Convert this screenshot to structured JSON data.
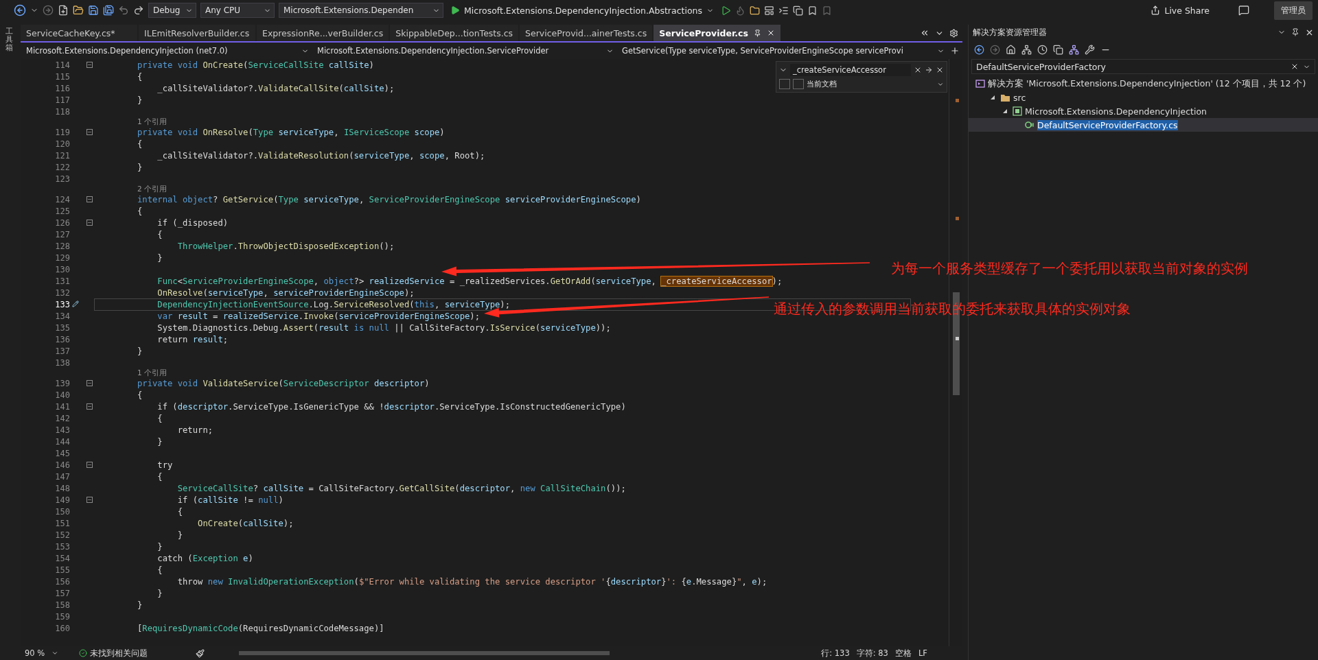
{
  "toolbar": {
    "configuration": "Debug",
    "platform": "Any CPU",
    "project": "Microsoft.Extensions.Dependen",
    "start_target": "Microsoft.Extensions.DependencyInjection.Abstractions",
    "live_share": "Live Share",
    "user_badge": "管理员"
  },
  "side_strip": {
    "label": "工具箱"
  },
  "tabs": [
    {
      "label": "ServiceCacheKey.cs*",
      "selected": false
    },
    {
      "label": "ILEmitResolverBuilder.cs",
      "selected": false
    },
    {
      "label": "ExpressionRe...verBuilder.cs",
      "selected": false
    },
    {
      "label": "SkippableDep...tionTests.cs",
      "selected": false
    },
    {
      "label": "ServiceProvid...ainerTests.cs",
      "selected": false
    },
    {
      "label": "ServiceProvider.cs",
      "selected": true
    }
  ],
  "nav_bar": {
    "project": "Microsoft.Extensions.DependencyInjection (net7.0)",
    "type": "Microsoft.Extensions.DependencyInjection.ServiceProvider",
    "member": "GetService(Type serviceType, ServiceProviderEngineScope serviceProvi"
  },
  "find": {
    "query": "_createServiceAccessor",
    "scope": "当前文档"
  },
  "code": {
    "lines": [
      {
        "kind": "code",
        "number": "114",
        "fold": true,
        "current": false,
        "tokens": [
          {
            "kind": "keyword",
            "text": "private void"
          },
          {
            "kind": "method",
            "text": " OnCreate"
          },
          {
            "kind": "plain",
            "text": "("
          },
          {
            "kind": "type",
            "text": "ServiceCallSite"
          },
          {
            "kind": "variable",
            "text": " callSite"
          },
          {
            "kind": "plain",
            "text": ")"
          }
        ]
      },
      {
        "kind": "code",
        "number": "115",
        "fold": false,
        "current": false,
        "tokens": [
          {
            "kind": "plain",
            "text": "{"
          }
        ]
      },
      {
        "kind": "code",
        "number": "116",
        "fold": false,
        "current": false,
        "tokens": [
          {
            "kind": "plain",
            "text": "    _callSiteValidator?."
          },
          {
            "kind": "method",
            "text": "ValidateCallSite"
          },
          {
            "kind": "plain",
            "text": "("
          },
          {
            "kind": "variable",
            "text": "callSite"
          },
          {
            "kind": "plain",
            "text": ");"
          }
        ]
      },
      {
        "kind": "code",
        "number": "117",
        "fold": false,
        "current": false,
        "tokens": [
          {
            "kind": "plain",
            "text": "}"
          }
        ]
      },
      {
        "kind": "code",
        "number": "118",
        "fold": false,
        "current": false
      },
      {
        "kind": "lens",
        "text": "1 个引用"
      },
      {
        "kind": "code",
        "number": "119",
        "fold": true,
        "current": false,
        "tokens": [
          {
            "kind": "keyword",
            "text": "private void"
          },
          {
            "kind": "method",
            "text": " OnResolve"
          },
          {
            "kind": "plain",
            "text": "("
          },
          {
            "kind": "type",
            "text": "Type"
          },
          {
            "kind": "variable",
            "text": " serviceType"
          },
          {
            "kind": "plain",
            "text": ", "
          },
          {
            "kind": "type",
            "text": "IServiceScope"
          },
          {
            "kind": "variable",
            "text": " scope"
          },
          {
            "kind": "plain",
            "text": ")"
          }
        ]
      },
      {
        "kind": "code",
        "number": "120",
        "fold": false,
        "current": false,
        "tokens": [
          {
            "kind": "plain",
            "text": "{"
          }
        ]
      },
      {
        "kind": "code",
        "number": "121",
        "fold": false,
        "current": false,
        "tokens": [
          {
            "kind": "plain",
            "text": "    _callSiteValidator?."
          },
          {
            "kind": "method",
            "text": "ValidateResolution"
          },
          {
            "kind": "plain",
            "text": "("
          },
          {
            "kind": "variable",
            "text": "serviceType"
          },
          {
            "kind": "plain",
            "text": ", "
          },
          {
            "kind": "variable",
            "text": "scope"
          },
          {
            "kind": "plain",
            "text": ", Root);"
          }
        ]
      },
      {
        "kind": "code",
        "number": "122",
        "fold": false,
        "current": false,
        "tokens": [
          {
            "kind": "plain",
            "text": "}"
          }
        ]
      },
      {
        "kind": "code",
        "number": "123",
        "fold": false,
        "current": false
      },
      {
        "kind": "lens",
        "text": "2 个引用"
      },
      {
        "kind": "code",
        "number": "124",
        "fold": true,
        "current": false,
        "tokens": [
          {
            "kind": "keyword",
            "text": "internal object"
          },
          {
            "kind": "plain",
            "text": "? "
          },
          {
            "kind": "method",
            "text": "GetService"
          },
          {
            "kind": "plain",
            "text": "("
          },
          {
            "kind": "type",
            "text": "Type"
          },
          {
            "kind": "variable",
            "text": " serviceType"
          },
          {
            "kind": "plain",
            "text": ", "
          },
          {
            "kind": "type",
            "text": "ServiceProviderEngineScope"
          },
          {
            "kind": "variable",
            "text": " serviceProviderEngineScope"
          },
          {
            "kind": "plain",
            "text": ")"
          }
        ]
      },
      {
        "kind": "code",
        "number": "125",
        "fold": false,
        "current": false,
        "tokens": [
          {
            "kind": "plain",
            "text": "{"
          }
        ]
      },
      {
        "kind": "code",
        "number": "126",
        "fold": true,
        "current": false,
        "tokens": [
          {
            "kind": "plain",
            "text": "    if (_disposed)"
          }
        ]
      },
      {
        "kind": "code",
        "number": "127",
        "fold": false,
        "current": false,
        "tokens": [
          {
            "kind": "plain",
            "text": "    {"
          }
        ]
      },
      {
        "kind": "code",
        "number": "128",
        "fold": false,
        "current": false,
        "tokens": [
          {
            "kind": "type",
            "text": "        ThrowHelper"
          },
          {
            "kind": "plain",
            "text": "."
          },
          {
            "kind": "method",
            "text": "ThrowObjectDisposedException"
          },
          {
            "kind": "plain",
            "text": "();"
          }
        ]
      },
      {
        "kind": "code",
        "number": "129",
        "fold": false,
        "current": false,
        "tokens": [
          {
            "kind": "plain",
            "text": "    }"
          }
        ]
      },
      {
        "kind": "code",
        "number": "130",
        "fold": false,
        "current": false
      },
      {
        "kind": "code",
        "number": "131",
        "fold": false,
        "current": false,
        "tokens": [
          {
            "kind": "type",
            "text": "    Func"
          },
          {
            "kind": "plain",
            "text": "<"
          },
          {
            "kind": "type",
            "text": "ServiceProviderEngineScope"
          },
          {
            "kind": "plain",
            "text": ", "
          },
          {
            "kind": "keyword",
            "text": "object"
          },
          {
            "kind": "plain",
            "text": "?> "
          },
          {
            "kind": "variable",
            "text": "realizedService"
          },
          {
            "kind": "plain",
            "text": " = _realizedServices."
          },
          {
            "kind": "method",
            "text": "GetOrAdd"
          },
          {
            "kind": "plain",
            "text": "("
          },
          {
            "kind": "variable",
            "text": "serviceType"
          },
          {
            "kind": "plain",
            "text": ", "
          },
          {
            "kind": "match",
            "text": "_createServiceAccessor"
          },
          {
            "kind": "plain",
            "text": ");"
          }
        ]
      },
      {
        "kind": "code",
        "number": "132",
        "fold": false,
        "current": false,
        "tokens": [
          {
            "kind": "method",
            "text": "    OnResolve"
          },
          {
            "kind": "plain",
            "text": "("
          },
          {
            "kind": "variable",
            "text": "serviceType"
          },
          {
            "kind": "plain",
            "text": ", "
          },
          {
            "kind": "variable",
            "text": "serviceProviderEngineScope"
          },
          {
            "kind": "plain",
            "text": ");"
          }
        ]
      },
      {
        "kind": "code",
        "number": "133",
        "fold": false,
        "current": true,
        "tokens": [
          {
            "kind": "type",
            "text": "    DependencyInjectionEventSource"
          },
          {
            "kind": "plain",
            "text": ".Log."
          },
          {
            "kind": "method",
            "text": "ServiceResolved"
          },
          {
            "kind": "plain",
            "text": "("
          },
          {
            "kind": "keyword",
            "text": "this"
          },
          {
            "kind": "plain",
            "text": ", "
          },
          {
            "kind": "variable",
            "text": "serviceType"
          },
          {
            "kind": "plain",
            "text": ");"
          }
        ]
      },
      {
        "kind": "code",
        "number": "134",
        "fold": false,
        "current": false,
        "tokens": [
          {
            "kind": "keyword",
            "text": "    var"
          },
          {
            "kind": "variable",
            "text": " result"
          },
          {
            "kind": "plain",
            "text": " = "
          },
          {
            "kind": "variable",
            "text": "realizedService"
          },
          {
            "kind": "plain",
            "text": "."
          },
          {
            "kind": "method",
            "text": "Invoke"
          },
          {
            "kind": "plain",
            "text": "("
          },
          {
            "kind": "variable",
            "text": "serviceProviderEngineScope"
          },
          {
            "kind": "plain",
            "text": ");"
          }
        ]
      },
      {
        "kind": "code",
        "number": "135",
        "fold": false,
        "current": false,
        "tokens": [
          {
            "kind": "plain",
            "text": "    System.Diagnostics.Debug."
          },
          {
            "kind": "method",
            "text": "Assert"
          },
          {
            "kind": "plain",
            "text": "("
          },
          {
            "kind": "variable",
            "text": "result"
          },
          {
            "kind": "keyword",
            "text": " is null"
          },
          {
            "kind": "plain",
            "text": " || CallSiteFactory."
          },
          {
            "kind": "method",
            "text": "IsService"
          },
          {
            "kind": "plain",
            "text": "("
          },
          {
            "kind": "variable",
            "text": "serviceType"
          },
          {
            "kind": "plain",
            "text": "));"
          }
        ]
      },
      {
        "kind": "code",
        "number": "136",
        "fold": false,
        "current": false,
        "tokens": [
          {
            "kind": "plain",
            "text": "    return "
          },
          {
            "kind": "variable",
            "text": "result"
          },
          {
            "kind": "plain",
            "text": ";"
          }
        ]
      },
      {
        "kind": "code",
        "number": "137",
        "fold": false,
        "current": false,
        "tokens": [
          {
            "kind": "plain",
            "text": "}"
          }
        ]
      },
      {
        "kind": "code",
        "number": "138",
        "fold": false,
        "current": false
      },
      {
        "kind": "lens",
        "text": "1 个引用"
      },
      {
        "kind": "code",
        "number": "139",
        "fold": true,
        "current": false,
        "tokens": [
          {
            "kind": "keyword",
            "text": "private void"
          },
          {
            "kind": "method",
            "text": " ValidateService"
          },
          {
            "kind": "plain",
            "text": "("
          },
          {
            "kind": "type",
            "text": "ServiceDescriptor"
          },
          {
            "kind": "variable",
            "text": " descriptor"
          },
          {
            "kind": "plain",
            "text": ")"
          }
        ]
      },
      {
        "kind": "code",
        "number": "140",
        "fold": false,
        "current": false,
        "tokens": [
          {
            "kind": "plain",
            "text": "{"
          }
        ]
      },
      {
        "kind": "code",
        "number": "141",
        "fold": true,
        "current": false,
        "tokens": [
          {
            "kind": "plain",
            "text": "    if ("
          },
          {
            "kind": "variable",
            "text": "descriptor"
          },
          {
            "kind": "plain",
            "text": ".ServiceType.IsGenericType && !"
          },
          {
            "kind": "variable",
            "text": "descriptor"
          },
          {
            "kind": "plain",
            "text": ".ServiceType.IsConstructedGenericType)"
          }
        ]
      },
      {
        "kind": "code",
        "number": "142",
        "fold": false,
        "current": false,
        "tokens": [
          {
            "kind": "plain",
            "text": "    {"
          }
        ]
      },
      {
        "kind": "code",
        "number": "143",
        "fold": false,
        "current": false,
        "tokens": [
          {
            "kind": "plain",
            "text": "        return;"
          }
        ]
      },
      {
        "kind": "code",
        "number": "144",
        "fold": false,
        "current": false,
        "tokens": [
          {
            "kind": "plain",
            "text": "    }"
          }
        ]
      },
      {
        "kind": "code",
        "number": "145",
        "fold": false,
        "current": false
      },
      {
        "kind": "code",
        "number": "146",
        "fold": true,
        "current": false,
        "tokens": [
          {
            "kind": "plain",
            "text": "    try"
          }
        ]
      },
      {
        "kind": "code",
        "number": "147",
        "fold": false,
        "current": false,
        "tokens": [
          {
            "kind": "plain",
            "text": "    {"
          }
        ]
      },
      {
        "kind": "code",
        "number": "148",
        "fold": false,
        "current": false,
        "tokens": [
          {
            "kind": "type",
            "text": "        ServiceCallSite"
          },
          {
            "kind": "plain",
            "text": "? "
          },
          {
            "kind": "variable",
            "text": "callSite"
          },
          {
            "kind": "plain",
            "text": " = CallSiteFactory."
          },
          {
            "kind": "method",
            "text": "GetCallSite"
          },
          {
            "kind": "plain",
            "text": "("
          },
          {
            "kind": "variable",
            "text": "descriptor"
          },
          {
            "kind": "plain",
            "text": ", "
          },
          {
            "kind": "keyword",
            "text": "new"
          },
          {
            "kind": "type",
            "text": " CallSiteChain"
          },
          {
            "kind": "plain",
            "text": "());"
          }
        ]
      },
      {
        "kind": "code",
        "number": "149",
        "fold": true,
        "current": false,
        "tokens": [
          {
            "kind": "plain",
            "text": "        if ("
          },
          {
            "kind": "variable",
            "text": "callSite"
          },
          {
            "kind": "plain",
            "text": " != "
          },
          {
            "kind": "keyword",
            "text": "null"
          },
          {
            "kind": "plain",
            "text": ")"
          }
        ]
      },
      {
        "kind": "code",
        "number": "150",
        "fold": false,
        "current": false,
        "tokens": [
          {
            "kind": "plain",
            "text": "        {"
          }
        ]
      },
      {
        "kind": "code",
        "number": "151",
        "fold": false,
        "current": false,
        "tokens": [
          {
            "kind": "method",
            "text": "            OnCreate"
          },
          {
            "kind": "plain",
            "text": "("
          },
          {
            "kind": "variable",
            "text": "callSite"
          },
          {
            "kind": "plain",
            "text": ");"
          }
        ]
      },
      {
        "kind": "code",
        "number": "152",
        "fold": false,
        "current": false,
        "tokens": [
          {
            "kind": "plain",
            "text": "        }"
          }
        ]
      },
      {
        "kind": "code",
        "number": "153",
        "fold": false,
        "current": false,
        "tokens": [
          {
            "kind": "plain",
            "text": "    }"
          }
        ]
      },
      {
        "kind": "code",
        "number": "154",
        "fold": false,
        "current": false,
        "tokens": [
          {
            "kind": "plain",
            "text": "    catch ("
          },
          {
            "kind": "type",
            "text": "Exception"
          },
          {
            "kind": "variable",
            "text": " e"
          },
          {
            "kind": "plain",
            "text": ")"
          }
        ]
      },
      {
        "kind": "code",
        "number": "155",
        "fold": false,
        "current": false,
        "tokens": [
          {
            "kind": "plain",
            "text": "    {"
          }
        ]
      },
      {
        "kind": "code",
        "number": "156",
        "fold": false,
        "current": false,
        "tokens": [
          {
            "kind": "plain",
            "text": "        throw "
          },
          {
            "kind": "keyword",
            "text": "new"
          },
          {
            "kind": "type",
            "text": " InvalidOperationException"
          },
          {
            "kind": "plain",
            "text": "("
          },
          {
            "kind": "string",
            "text": "$\"Error while validating the service descriptor '"
          },
          {
            "kind": "plain",
            "text": "{"
          },
          {
            "kind": "variable",
            "text": "descriptor"
          },
          {
            "kind": "plain",
            "text": "}"
          },
          {
            "kind": "string",
            "text": "': "
          },
          {
            "kind": "plain",
            "text": "{"
          },
          {
            "kind": "variable",
            "text": "e"
          },
          {
            "kind": "plain",
            "text": ".Message}"
          },
          {
            "kind": "string",
            "text": "\""
          },
          {
            "kind": "plain",
            "text": ", "
          },
          {
            "kind": "variable",
            "text": "e"
          },
          {
            "kind": "plain",
            "text": ");"
          }
        ]
      },
      {
        "kind": "code",
        "number": "157",
        "fold": false,
        "current": false,
        "tokens": [
          {
            "kind": "plain",
            "text": "    }"
          }
        ]
      },
      {
        "kind": "code",
        "number": "158",
        "fold": false,
        "current": false,
        "tokens": [
          {
            "kind": "plain",
            "text": "}"
          }
        ]
      },
      {
        "kind": "code",
        "number": "159",
        "fold": false,
        "current": false
      },
      {
        "kind": "code",
        "number": "160",
        "fold": false,
        "current": false,
        "tokens": [
          {
            "kind": "plain",
            "text": "["
          },
          {
            "kind": "type",
            "text": "RequiresDynamicCode"
          },
          {
            "kind": "plain",
            "text": "(RequiresDynamicCodeMessage)]"
          }
        ]
      }
    ]
  },
  "annotations": [
    {
      "text": "为每一个服务类型缓存了一个委托用以获取当前对象的实例"
    },
    {
      "text": "通过传入的参数调用当前获取的委托来获取具体的实例对象"
    }
  ],
  "status_bar": {
    "zoom": "90 %",
    "issues": "未找到相关问题",
    "line": "行: 133",
    "column": "字符: 83",
    "indent": "空格",
    "eol": "LF"
  },
  "solution_explorer": {
    "title": "解决方案资源管理器",
    "search": "DefaultServiceProviderFactory",
    "tree": [
      {
        "kind": "solution",
        "label": "解决方案 'Microsoft.Extensions.DependencyInjection' (12 个项目，共 12 个)",
        "selected": false,
        "children": [
          {
            "kind": "folder",
            "label": "src",
            "expanded": true,
            "selected": false,
            "children": [
              {
                "kind": "project",
                "label": "Microsoft.Extensions.DependencyInjection",
                "expanded": true,
                "selected": false,
                "children": [
                  {
                    "kind": "file",
                    "label": "DefaultServiceProviderFactory.cs",
                    "selected": true
                  }
                ]
              }
            ]
          }
        ]
      }
    ]
  }
}
